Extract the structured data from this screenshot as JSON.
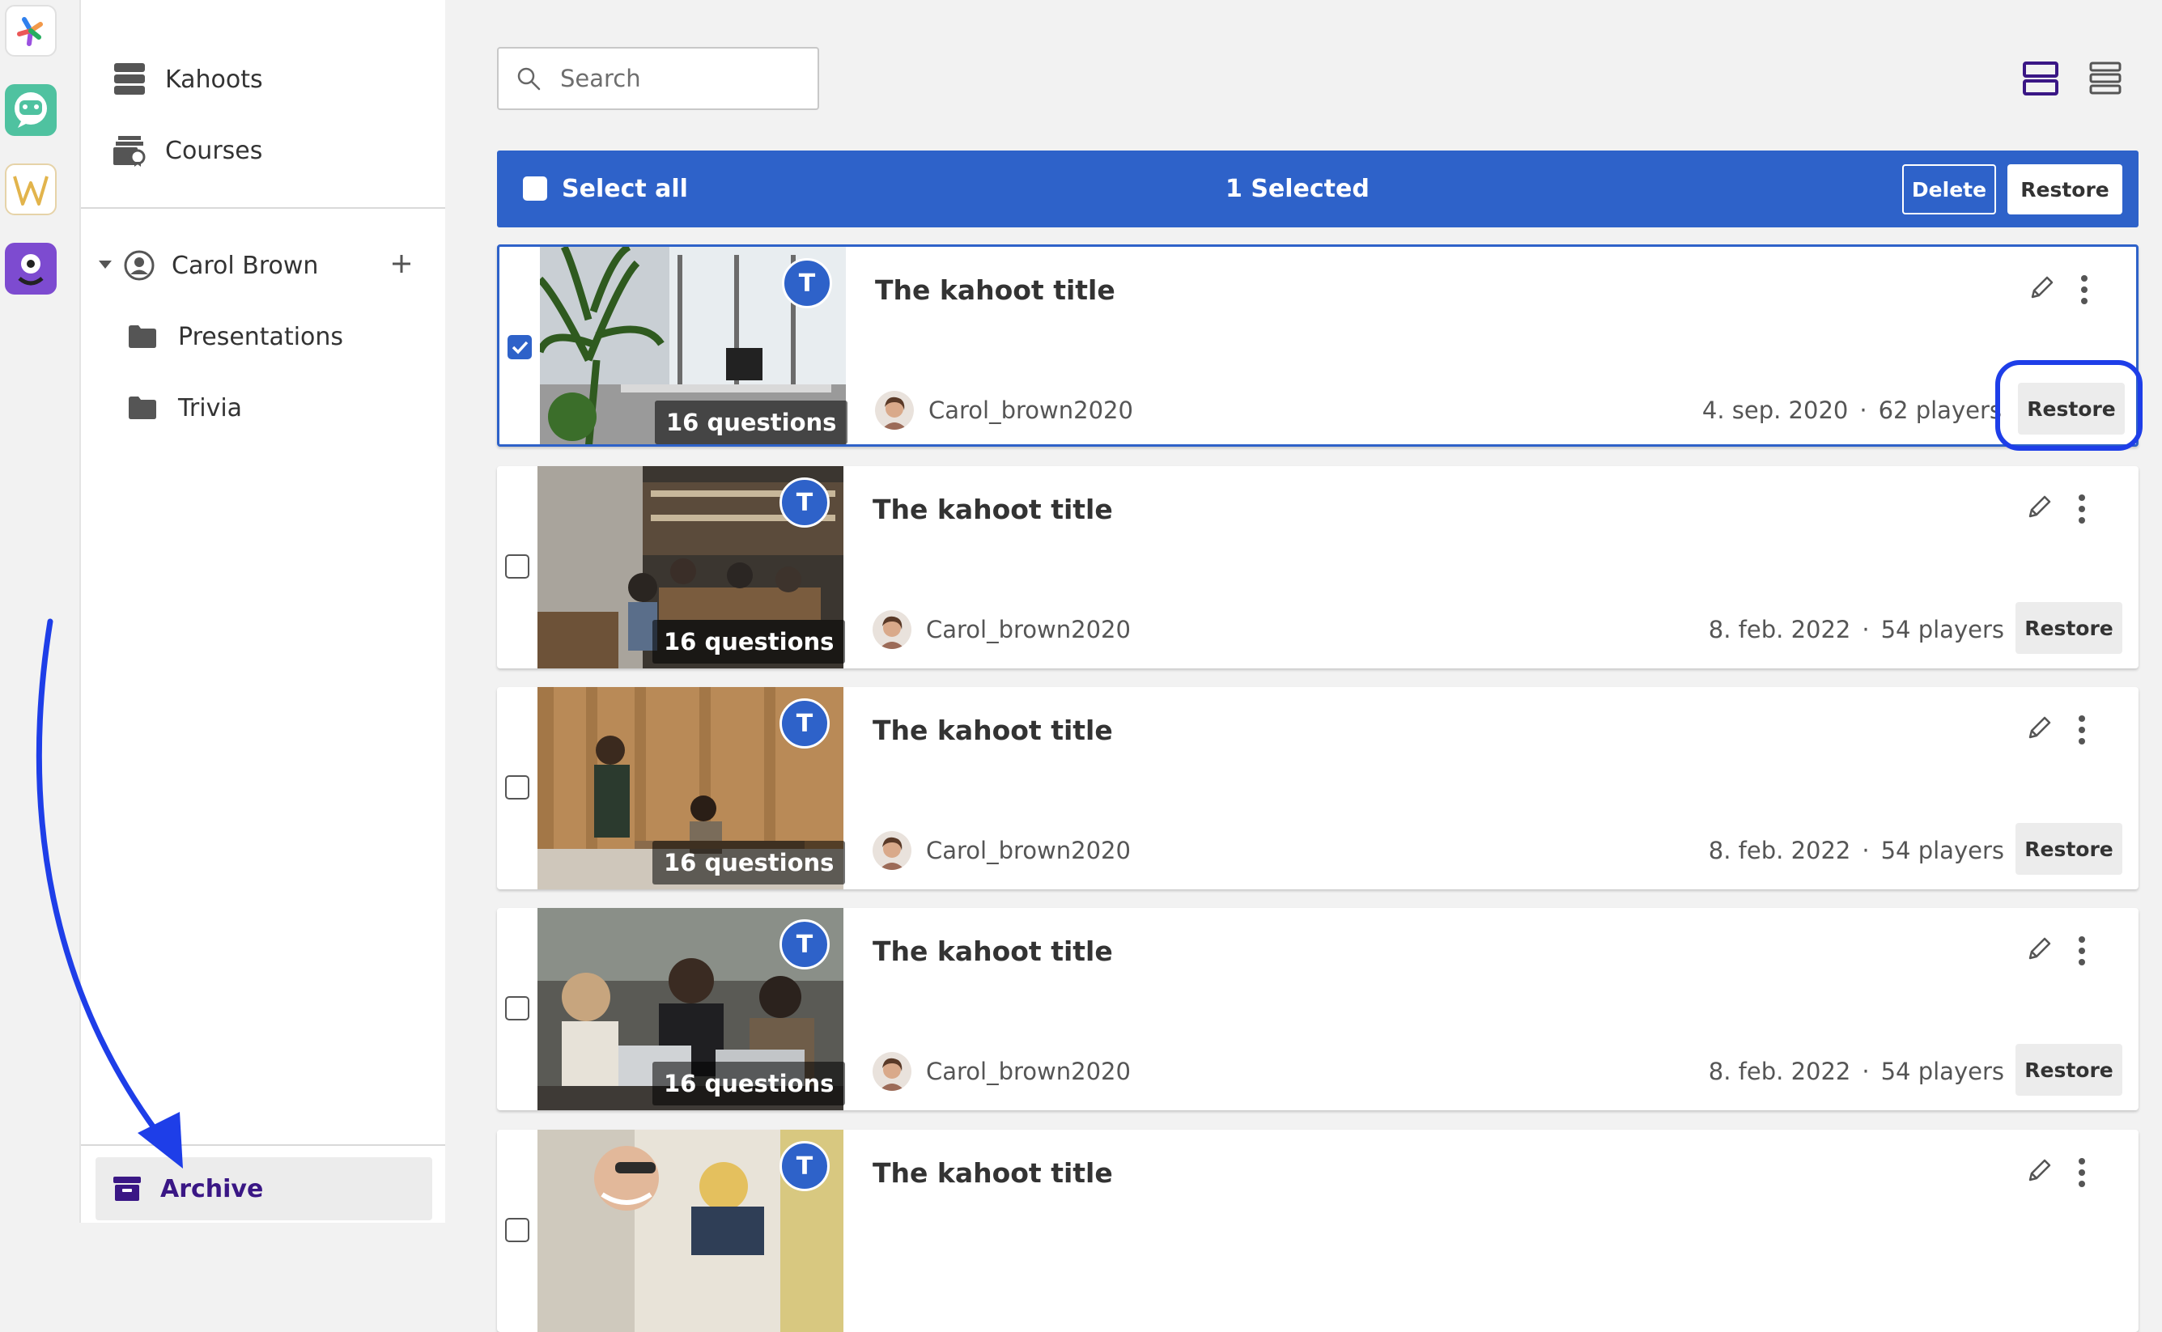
{
  "apps": [
    {
      "name": "Kahoot app",
      "icon": "star-logo-icon"
    },
    {
      "name": "Chat app",
      "icon": "robot-chat-icon"
    },
    {
      "name": "Word app",
      "icon": "w-logo-icon"
    },
    {
      "name": "Monster app",
      "icon": "monster-icon"
    }
  ],
  "sidebar": {
    "top_items": [
      {
        "label": "Kahoots",
        "icon": "stack-icon"
      },
      {
        "label": "Courses",
        "icon": "courses-icon"
      }
    ],
    "workspace": {
      "owner": "Carol Brown",
      "add_icon": "plus-icon"
    },
    "folders": [
      {
        "label": "Presentations",
        "icon": "folder-icon"
      },
      {
        "label": "Trivia",
        "icon": "folder-icon"
      }
    ],
    "archive_label": "Archive"
  },
  "search": {
    "placeholder": "Search"
  },
  "selection_bar": {
    "select_all_label": "Select all",
    "selected_count": "1 Selected",
    "delete_label": "Delete",
    "restore_label": "Restore",
    "color": "#2e62c9"
  },
  "kahoots": [
    {
      "title": "The kahoot title",
      "badge": "T",
      "questions": "16 questions",
      "author": "Carol_brown2020",
      "date": "4. sep. 2020",
      "players": "62 players",
      "restore_label": "Restore",
      "selected": true
    },
    {
      "title": "The kahoot title",
      "badge": "T",
      "questions": "16 questions",
      "author": "Carol_brown2020",
      "date": "8. feb. 2022",
      "players": "54 players",
      "restore_label": "Restore",
      "selected": false
    },
    {
      "title": "The kahoot title",
      "badge": "T",
      "questions": "16 questions",
      "author": "Carol_brown2020",
      "date": "8. feb. 2022",
      "players": "54 players",
      "restore_label": "Restore",
      "selected": false
    },
    {
      "title": "The kahoot title",
      "badge": "T",
      "questions": "16 questions",
      "author": "Carol_brown2020",
      "date": "8. feb. 2022",
      "players": "54 players",
      "restore_label": "Restore",
      "selected": false
    },
    {
      "title": "The kahoot title",
      "badge": "T",
      "questions": "",
      "author": "",
      "date": "",
      "players": "",
      "restore_label": "",
      "selected": false
    }
  ],
  "annotation_color": "#1e3ee8"
}
